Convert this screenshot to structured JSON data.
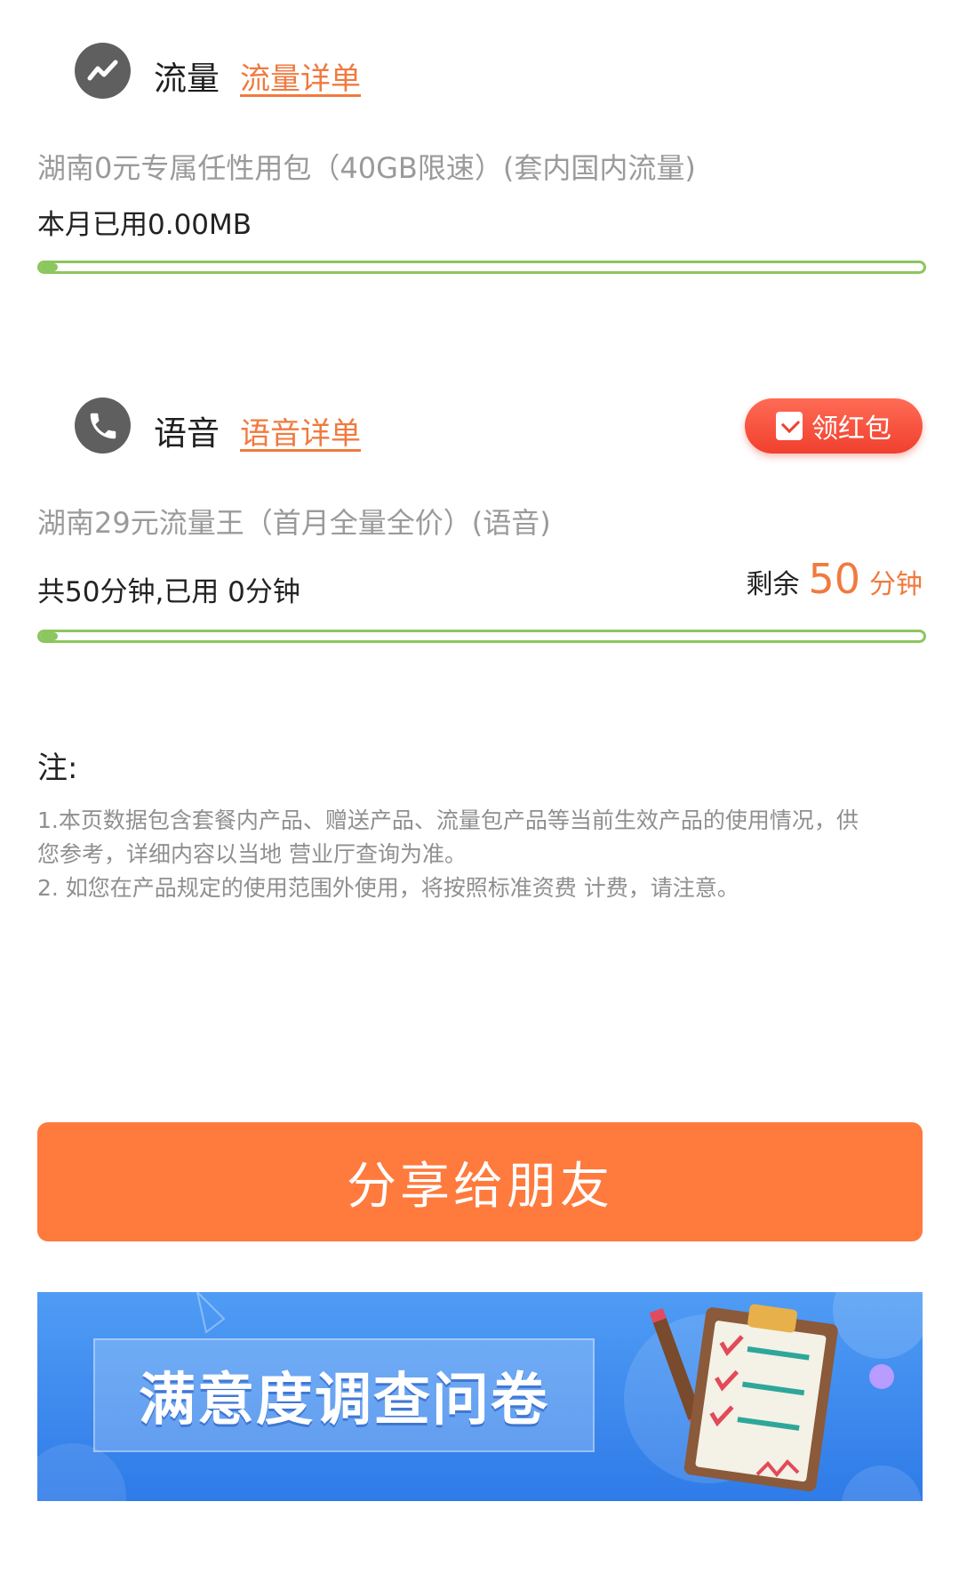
{
  "data_section": {
    "title": "流量",
    "detail_link": "流量详单",
    "plan": "湖南0元专属任性用包（40GB限速）(套内国内流量)",
    "usage": "本月已用0.00MB",
    "progress": 0.02
  },
  "voice_section": {
    "title": "语音",
    "detail_link": "语音详单",
    "red_packet": "领红包",
    "plan": "湖南29元流量王（首月全量全价）(语音)",
    "usage": "共50分钟,已用 0分钟",
    "remaining_prefix": "剩余",
    "remaining_value": "50",
    "remaining_unit": "分钟",
    "progress": 0.02
  },
  "notes": {
    "title": "注:",
    "line1": "1.本页数据包含套餐内产品、赠送产品、流量包产品等当前生效产品的使用情况，供",
    "line2": "您参考，详细内容以当地 营业厅查询为准。",
    "line3": "2. 如您在产品规定的使用范围外使用，将按照标准资费 计费，请注意。"
  },
  "share_button": "分享给朋友",
  "banner": {
    "text": "满意度调查问卷"
  },
  "colors": {
    "accent_orange": "#ff7a3d",
    "progress_green": "#8cc65e",
    "red_packet": "#f0402e",
    "banner_blue": "#3b88ee"
  }
}
